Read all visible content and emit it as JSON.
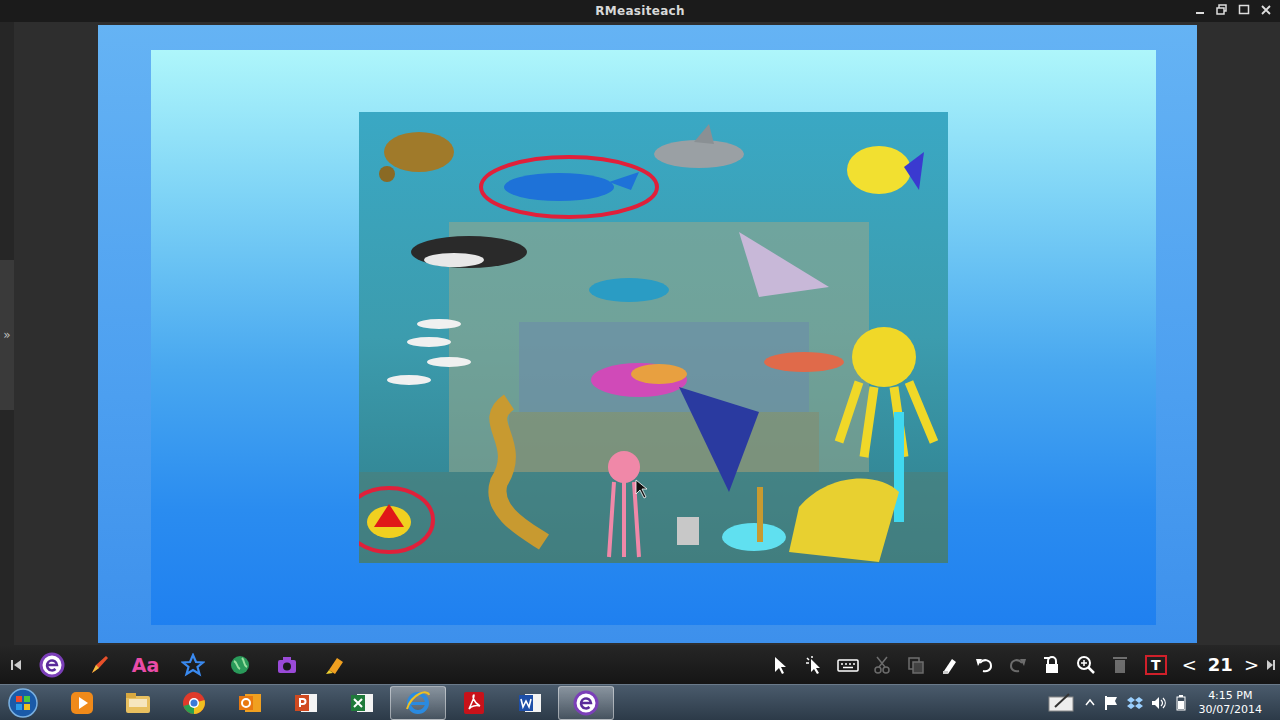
{
  "window": {
    "title": "RMeasiteach"
  },
  "side_panel": {
    "toggle": "»"
  },
  "text_tool": {
    "label": "Aa"
  },
  "right_tools": [
    {
      "kind": "pointer",
      "disabled": false
    },
    {
      "kind": "magic-pointer",
      "disabled": false
    },
    {
      "kind": "keyboard",
      "disabled": false
    },
    {
      "kind": "cut",
      "disabled": true
    },
    {
      "kind": "copy",
      "disabled": true
    },
    {
      "kind": "paint",
      "disabled": false
    },
    {
      "kind": "undo",
      "disabled": false
    },
    {
      "kind": "redo",
      "disabled": true
    },
    {
      "kind": "lock",
      "disabled": false
    },
    {
      "kind": "zoom",
      "disabled": false
    },
    {
      "kind": "delete",
      "disabled": true
    }
  ],
  "text_toggle": {
    "label": "T",
    "on": true
  },
  "page_nav": {
    "prev": "<",
    "page": "21",
    "next": ">"
  },
  "taskbar": {
    "apps": [
      {
        "kind": "media-player",
        "active": false
      },
      {
        "kind": "explorer",
        "active": false
      },
      {
        "kind": "chrome",
        "active": false
      },
      {
        "kind": "outlook",
        "active": false
      },
      {
        "kind": "powerpoint",
        "active": false
      },
      {
        "kind": "excel",
        "active": false
      },
      {
        "kind": "internet-explorer",
        "active": true
      },
      {
        "kind": "acrobat",
        "active": false
      },
      {
        "kind": "word",
        "active": false
      },
      {
        "kind": "easiteach",
        "active": true
      }
    ]
  },
  "clock": {
    "time": "4:15 PM",
    "date": "30/07/2014"
  }
}
